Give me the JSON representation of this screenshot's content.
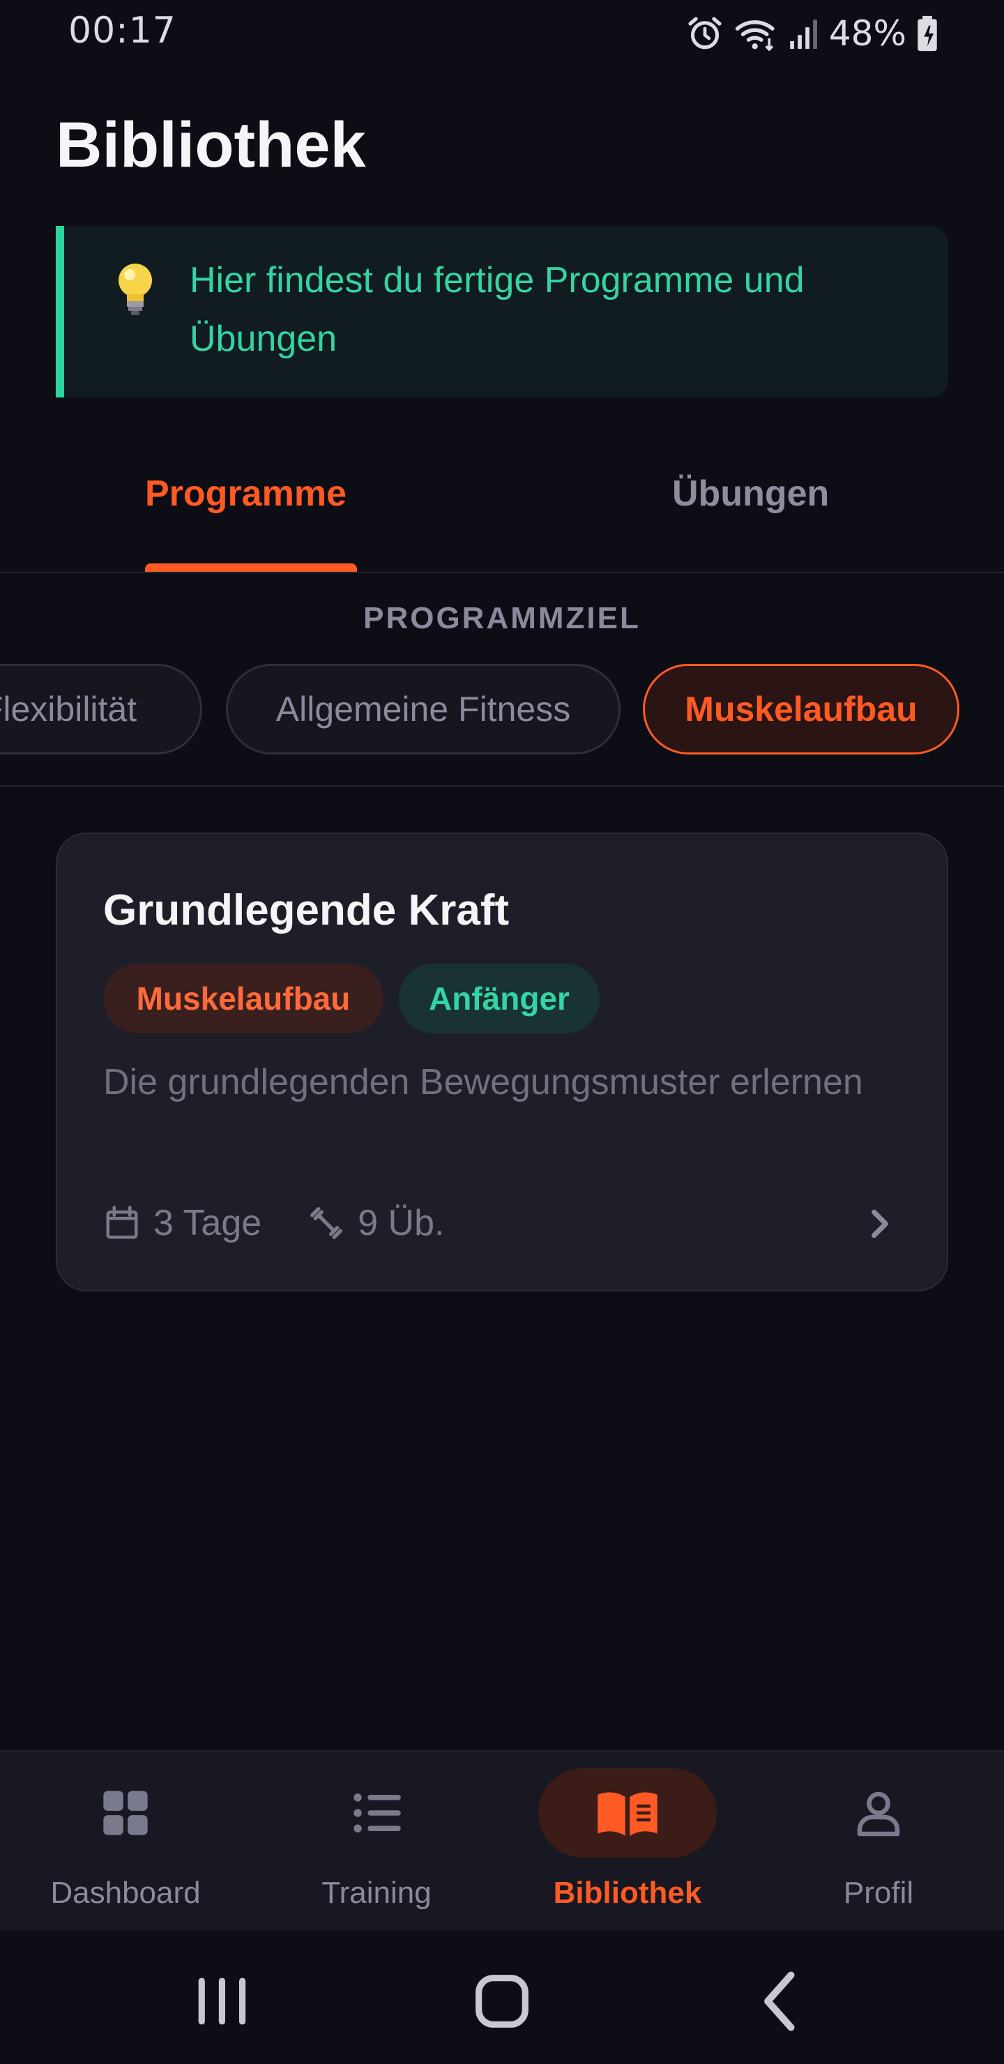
{
  "status_bar": {
    "time": "00:17",
    "battery": "48%",
    "icons": [
      "alarm-icon",
      "wifi-icon",
      "signal-icon",
      "battery-icon"
    ]
  },
  "header": {
    "title": "Bibliothek"
  },
  "hint": {
    "icon": "lightbulb-icon",
    "text": "Hier findest du fertige Programme und Übungen"
  },
  "tabs": [
    {
      "label": "Programme",
      "active": true
    },
    {
      "label": "Übungen",
      "active": false
    }
  ],
  "filter": {
    "label": "PROGRAMMZIEL",
    "chips": [
      {
        "label": "Flexibilität",
        "selected": false
      },
      {
        "label": "Allgemeine Fitness",
        "selected": false
      },
      {
        "label": "Muskelaufbau",
        "selected": true
      }
    ]
  },
  "program_cards": [
    {
      "title": "Grundlegende Kraft",
      "goal_badge": "Muskelaufbau",
      "level_badge": "Anfänger",
      "description": "Die grundlegenden Bewegungsmuster erlernen",
      "days": "3 Tage",
      "exercises": "9 Üb."
    }
  ],
  "bottom_nav": [
    {
      "label": "Dashboard",
      "icon": "grid-icon",
      "active": false
    },
    {
      "label": "Training",
      "icon": "list-icon",
      "active": false
    },
    {
      "label": "Bibliothek",
      "icon": "book-icon",
      "active": true
    },
    {
      "label": "Profil",
      "icon": "person-icon",
      "active": false
    }
  ],
  "system_nav": [
    "recents-icon",
    "home-icon",
    "back-icon"
  ],
  "colors": {
    "background": "#0d0e15",
    "accent": "#ff5a24",
    "teal": "#34d4a4",
    "card": "#1e1e29"
  }
}
